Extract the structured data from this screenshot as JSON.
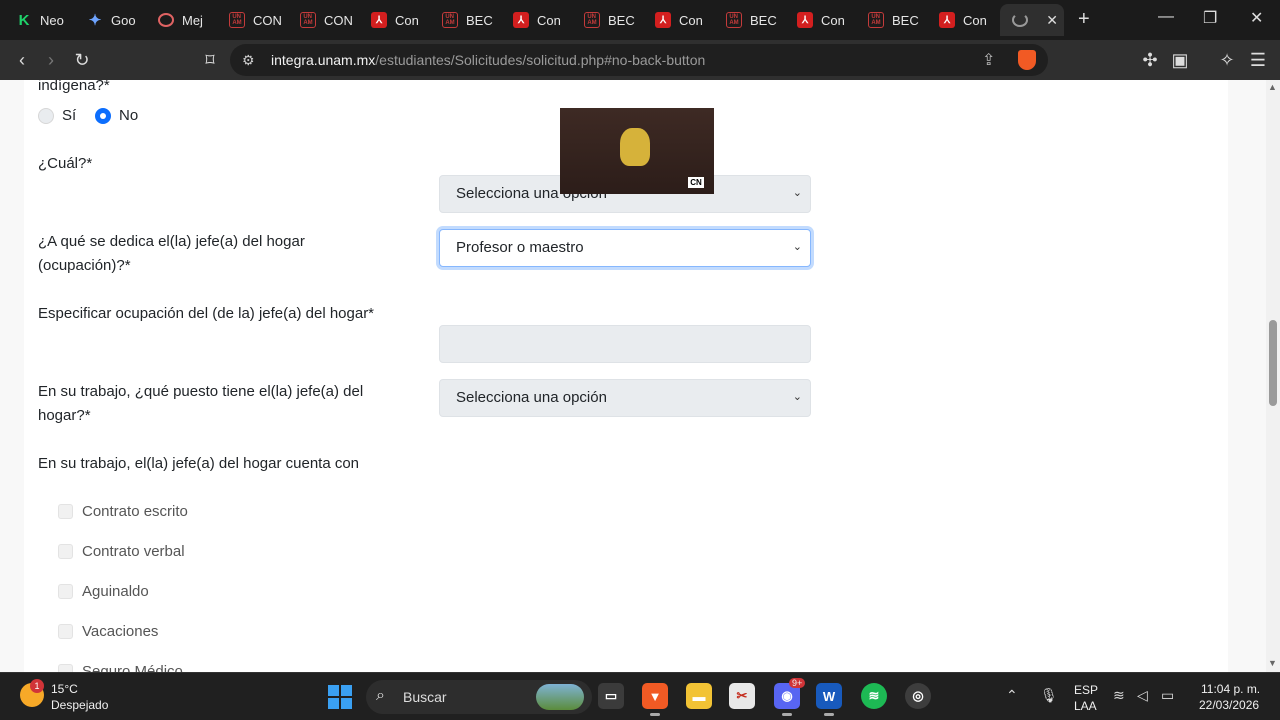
{
  "tabs": [
    {
      "label": "Neo",
      "icon": "k-icon"
    },
    {
      "label": "Goo",
      "icon": "gemini-icon"
    },
    {
      "label": "Mej",
      "icon": "camera-icon"
    },
    {
      "label": "CON",
      "icon": "unam-icon"
    },
    {
      "label": "CON",
      "icon": "unam-icon"
    },
    {
      "label": "Con",
      "icon": "pdf-icon"
    },
    {
      "label": "BEC",
      "icon": "unam-icon"
    },
    {
      "label": "Con",
      "icon": "pdf-icon"
    },
    {
      "label": "BEC",
      "icon": "unam-icon"
    },
    {
      "label": "Con",
      "icon": "pdf-icon"
    },
    {
      "label": "BEC",
      "icon": "unam-icon"
    },
    {
      "label": "Con",
      "icon": "pdf-icon"
    },
    {
      "label": "BEC",
      "icon": "unam-icon"
    },
    {
      "label": "Con",
      "icon": "pdf-icon"
    }
  ],
  "address": {
    "host": "integra.unam.mx",
    "path": "/estudiantes/Solicitudes/solicitud.php#no-back-button"
  },
  "form": {
    "indigena_label": "indígena?*",
    "radio_si": "Sí",
    "radio_no": "No",
    "selected_radio": "No",
    "cual_label": "¿Cuál?*",
    "cual_select": "Selecciona una opción",
    "ocupacion_label_line1": "¿A qué se dedica el(la) jefe(a) del hogar",
    "ocupacion_label_line2": "(ocupación)?*",
    "ocupacion_select": "Profesor o maestro",
    "especificar_label": "Especificar ocupación del (de la) jefe(a) del hogar*",
    "especificar_value": "",
    "puesto_label_line1": "En su trabajo, ¿qué puesto tiene el(la) jefe(a) del",
    "puesto_label_line2": "hogar?*",
    "puesto_select": "Selecciona una opción",
    "cuenta_con_label": "En su trabajo, el(la) jefe(a) del hogar cuenta con",
    "checkboxes": [
      "Contrato escrito",
      "Contrato verbal",
      "Aguinaldo",
      "Vacaciones",
      "Seguro Médico"
    ]
  },
  "taskbar": {
    "temperature": "15°C",
    "condition": "Despejado",
    "weather_badge": "1",
    "search_label": "Buscar",
    "language": "ESP",
    "layout": "LAA",
    "time": "11:04 p. m.",
    "date": "22/03/2026",
    "discord_badge": "9+"
  }
}
